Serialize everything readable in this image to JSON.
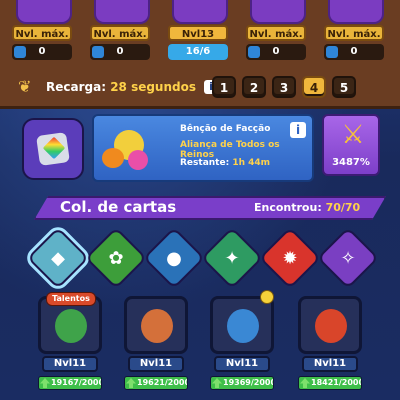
{
  "deck_cards": [
    {
      "level_label": "Nvl. máx.",
      "count": "0",
      "art": "#7b3cc1",
      "count_full": false
    },
    {
      "level_label": "Nvl. máx.",
      "count": "0",
      "art": "#6d37ba",
      "count_full": false
    },
    {
      "level_label": "Nvl13",
      "count": "16/6",
      "art": "#7a3cc4",
      "count_full": true
    },
    {
      "level_label": "Nvl. máx.",
      "count": "0",
      "art": "#6d37ba",
      "count_full": false
    },
    {
      "level_label": "Nvl. máx.",
      "count": "0",
      "art": "#7b3cc1",
      "count_full": false
    }
  ],
  "recharge": {
    "label": "Recarga:",
    "value": "28 segundos",
    "info": "i"
  },
  "deck_tabs": [
    "1",
    "2",
    "3",
    "4",
    "5"
  ],
  "deck_tab_active_index": 3,
  "blessing": {
    "title": "Bênção de Facção",
    "name": "Aliança de Todos os Reinos",
    "remaining_label": "Restante:",
    "remaining_value": "1h 44m",
    "info": "i"
  },
  "bonus": {
    "value": "3487%"
  },
  "collection": {
    "title": "Col. de cartas",
    "found_label": "Encontrou:",
    "found_value": "70/70"
  },
  "factions": [
    {
      "name": "all-factions",
      "color": "#5fb2c8",
      "glyph": "◆",
      "selected": true
    },
    {
      "name": "forest",
      "color": "#3d9e3a",
      "glyph": "✿",
      "selected": false
    },
    {
      "name": "dark-orb",
      "color": "#2a72b8",
      "glyph": "●",
      "selected": false
    },
    {
      "name": "wings",
      "color": "#2e9b62",
      "glyph": "✦",
      "selected": false
    },
    {
      "name": "fire-lamp",
      "color": "#d9342c",
      "glyph": "✹",
      "selected": false
    },
    {
      "name": "bat",
      "color": "#7a3fc2",
      "glyph": "✧",
      "selected": false
    }
  ],
  "cards": [
    {
      "level": "Nvl11",
      "progress": "19167/2000",
      "fill": 1.0,
      "hero": "#3fa34a",
      "talent": "Talentos",
      "dot": false
    },
    {
      "level": "Nvl11",
      "progress": "19621/2000",
      "fill": 1.0,
      "hero": "#d4703a",
      "talent": "",
      "dot": false
    },
    {
      "level": "Nvl11",
      "progress": "19369/2000",
      "fill": 1.0,
      "hero": "#3a88d4",
      "talent": "",
      "dot": true
    },
    {
      "level": "Nvl11",
      "progress": "18421/2000",
      "fill": 1.0,
      "hero": "#d9452a",
      "talent": "",
      "dot": false
    }
  ]
}
